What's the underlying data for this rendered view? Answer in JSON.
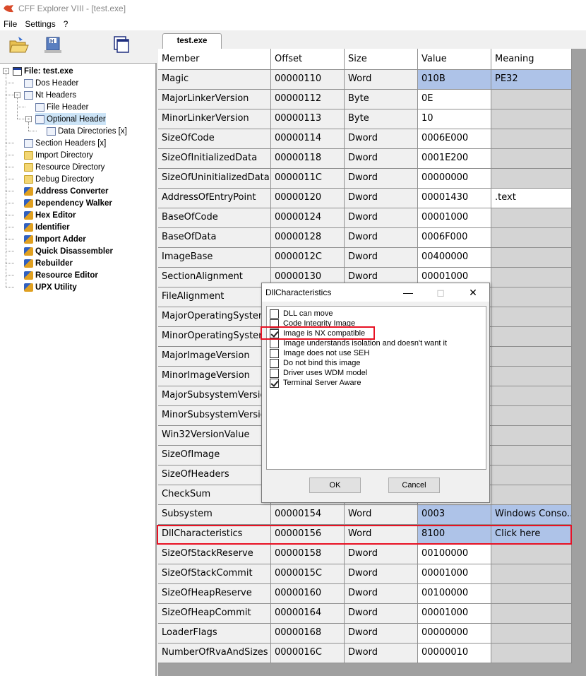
{
  "window": {
    "title": "CFF Explorer VIII - [test.exe]"
  },
  "menu": [
    "File",
    "Settings",
    "?"
  ],
  "tab": {
    "label": "test.exe"
  },
  "tree": [
    {
      "label": "File: test.exe",
      "level": 0,
      "bold": true,
      "icon": "window-icon",
      "expander": "-"
    },
    {
      "label": "Dos Header",
      "level": 1,
      "icon": "doc-icon"
    },
    {
      "label": "Nt Headers",
      "level": 1,
      "icon": "doc-icon",
      "expander": "-"
    },
    {
      "label": "File Header",
      "level": 2,
      "icon": "doc-icon"
    },
    {
      "label": "Optional Header",
      "level": 2,
      "icon": "doc-icon",
      "expander": "-",
      "selected": true
    },
    {
      "label": "Data Directories [x]",
      "level": 3,
      "icon": "doc-icon"
    },
    {
      "label": "Section Headers [x]",
      "level": 1,
      "icon": "doc-icon"
    },
    {
      "label": "Import Directory",
      "level": 1,
      "icon": "folder-icon"
    },
    {
      "label": "Resource Directory",
      "level": 1,
      "icon": "folder-icon"
    },
    {
      "label": "Debug Directory",
      "level": 1,
      "icon": "folder-icon"
    },
    {
      "label": "Address Converter",
      "level": 1,
      "bold": true,
      "icon": "tool-icon"
    },
    {
      "label": "Dependency Walker",
      "level": 1,
      "bold": true,
      "icon": "tool-icon"
    },
    {
      "label": "Hex Editor",
      "level": 1,
      "bold": true,
      "icon": "tool-icon"
    },
    {
      "label": "Identifier",
      "level": 1,
      "bold": true,
      "icon": "tool-icon"
    },
    {
      "label": "Import Adder",
      "level": 1,
      "bold": true,
      "icon": "tool-icon"
    },
    {
      "label": "Quick Disassembler",
      "level": 1,
      "bold": true,
      "icon": "tool-icon"
    },
    {
      "label": "Rebuilder",
      "level": 1,
      "bold": true,
      "icon": "tool-icon"
    },
    {
      "label": "Resource Editor",
      "level": 1,
      "bold": true,
      "icon": "tool-icon"
    },
    {
      "label": "UPX Utility",
      "level": 1,
      "bold": true,
      "icon": "tool-icon"
    }
  ],
  "table": {
    "columns": [
      "Member",
      "Offset",
      "Size",
      "Value",
      "Meaning"
    ],
    "rows": [
      [
        "Magic",
        "00000110",
        "Word",
        "010B",
        "PE32"
      ],
      [
        "MajorLinkerVersion",
        "00000112",
        "Byte",
        "0E",
        ""
      ],
      [
        "MinorLinkerVersion",
        "00000113",
        "Byte",
        "10",
        ""
      ],
      [
        "SizeOfCode",
        "00000114",
        "Dword",
        "0006E000",
        ""
      ],
      [
        "SizeOfInitializedData",
        "00000118",
        "Dword",
        "0001E200",
        ""
      ],
      [
        "SizeOfUninitializedData",
        "0000011C",
        "Dword",
        "00000000",
        ""
      ],
      [
        "AddressOfEntryPoint",
        "00000120",
        "Dword",
        "00001430",
        ".text"
      ],
      [
        "BaseOfCode",
        "00000124",
        "Dword",
        "00001000",
        ""
      ],
      [
        "BaseOfData",
        "00000128",
        "Dword",
        "0006F000",
        ""
      ],
      [
        "ImageBase",
        "0000012C",
        "Dword",
        "00400000",
        ""
      ],
      [
        "SectionAlignment",
        "00000130",
        "Dword",
        "00001000",
        ""
      ],
      [
        "FileAlignment",
        "",
        "",
        "",
        ""
      ],
      [
        "MajorOperatingSystem...",
        "",
        "",
        "",
        ""
      ],
      [
        "MinorOperatingSystem...",
        "",
        "",
        "",
        ""
      ],
      [
        "MajorImageVersion",
        "",
        "",
        "",
        ""
      ],
      [
        "MinorImageVersion",
        "",
        "",
        "",
        ""
      ],
      [
        "MajorSubsystemVersion",
        "",
        "",
        "",
        ""
      ],
      [
        "MinorSubsystemVersion",
        "",
        "",
        "",
        ""
      ],
      [
        "Win32VersionValue",
        "",
        "",
        "",
        ""
      ],
      [
        "SizeOfImage",
        "",
        "",
        "",
        ""
      ],
      [
        "SizeOfHeaders",
        "",
        "",
        "",
        ""
      ],
      [
        "CheckSum",
        "",
        "",
        "",
        ""
      ],
      [
        "Subsystem",
        "00000154",
        "Word",
        "0003",
        "Windows Conso..."
      ],
      [
        "DllCharacteristics",
        "00000156",
        "Word",
        "8100",
        "Click here"
      ],
      [
        "SizeOfStackReserve",
        "00000158",
        "Dword",
        "00100000",
        ""
      ],
      [
        "SizeOfStackCommit",
        "0000015C",
        "Dword",
        "00001000",
        ""
      ],
      [
        "SizeOfHeapReserve",
        "00000160",
        "Dword",
        "00100000",
        ""
      ],
      [
        "SizeOfHeapCommit",
        "00000164",
        "Dword",
        "00001000",
        ""
      ],
      [
        "LoaderFlags",
        "00000168",
        "Dword",
        "00000000",
        ""
      ],
      [
        "NumberOfRvaAndSizes",
        "0000016C",
        "Dword",
        "00000010",
        ""
      ]
    ]
  },
  "dialog": {
    "title": "DllCharacteristics",
    "options": [
      {
        "label": "DLL can move",
        "checked": false
      },
      {
        "label": "Code Integrity Image",
        "checked": false
      },
      {
        "label": "Image is NX compatible",
        "checked": true
      },
      {
        "label": "Image understands isolation and doesn't want it",
        "checked": false
      },
      {
        "label": "Image does not use SEH",
        "checked": false
      },
      {
        "label": "Do not bind this image",
        "checked": false
      },
      {
        "label": "Driver uses WDM model",
        "checked": false
      },
      {
        "label": "Terminal Server Aware",
        "checked": true
      }
    ],
    "ok_label": "OK",
    "cancel_label": "Cancel"
  },
  "colors": {
    "selection": "#aec3e8",
    "highlight_box": "#e81123",
    "tree_selection": "#cce4f7"
  }
}
